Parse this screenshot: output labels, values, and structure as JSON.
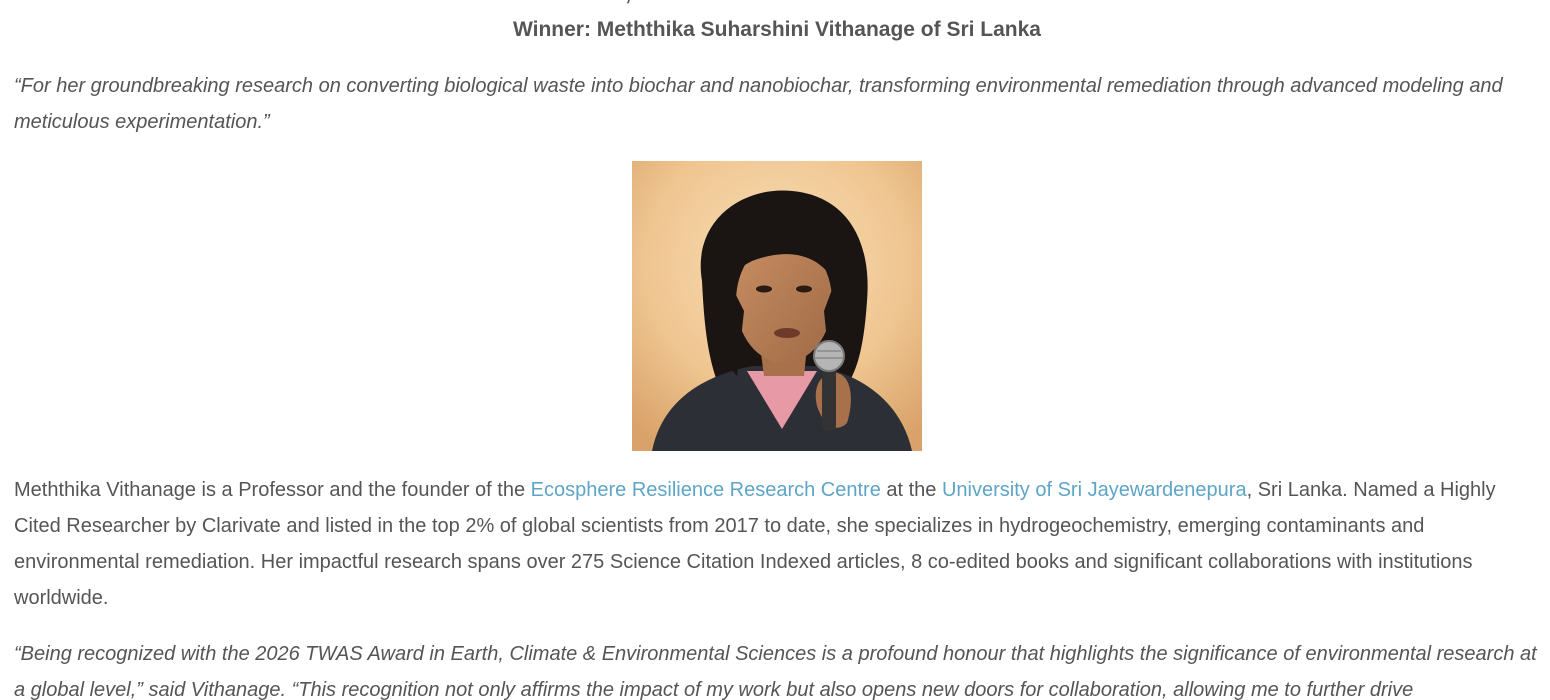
{
  "article": {
    "top_heading": "Earth, Climate & Environmental Sciences",
    "winner_heading": "Winner: Meththika Suharshini Vithanage of Sri Lanka",
    "citation": "“For her groundbreaking research on converting biological waste into biochar and nanobiochar, transforming environmental remediation through advanced modeling and meticulous experimentation.”",
    "photo_alt": "Meththika Vithanage speaking into a microphone",
    "bio": {
      "part1": "Meththika Vithanage is a Professor and the founder of the ",
      "link1": "Ecosphere Resilience Research Centre",
      "part2": " at the ",
      "link2": "University of Sri Jayewardenepura",
      "part3": ", Sri Lanka. Named a Highly Cited Researcher by Clarivate and listed in the top 2% of global scientists from 2017 to date, she specializes in hydrogeochemistry, emerging contaminants and environmental remediation. Her impactful research spans over 275 Science Citation Indexed articles, 8 co-edited books and significant collaborations with institutions worldwide."
    },
    "quote": "“Being recognized with the 2026 TWAS Award in Earth, Climate & Environmental Sciences is a profound honour that highlights the significance of environmental research at a global level,” said Vithanage. “This recognition not only affirms the impact of my work but also opens new doors for collaboration, allowing me to further drive"
  },
  "colors": {
    "text": "#555555",
    "link": "#5ea5c7"
  }
}
